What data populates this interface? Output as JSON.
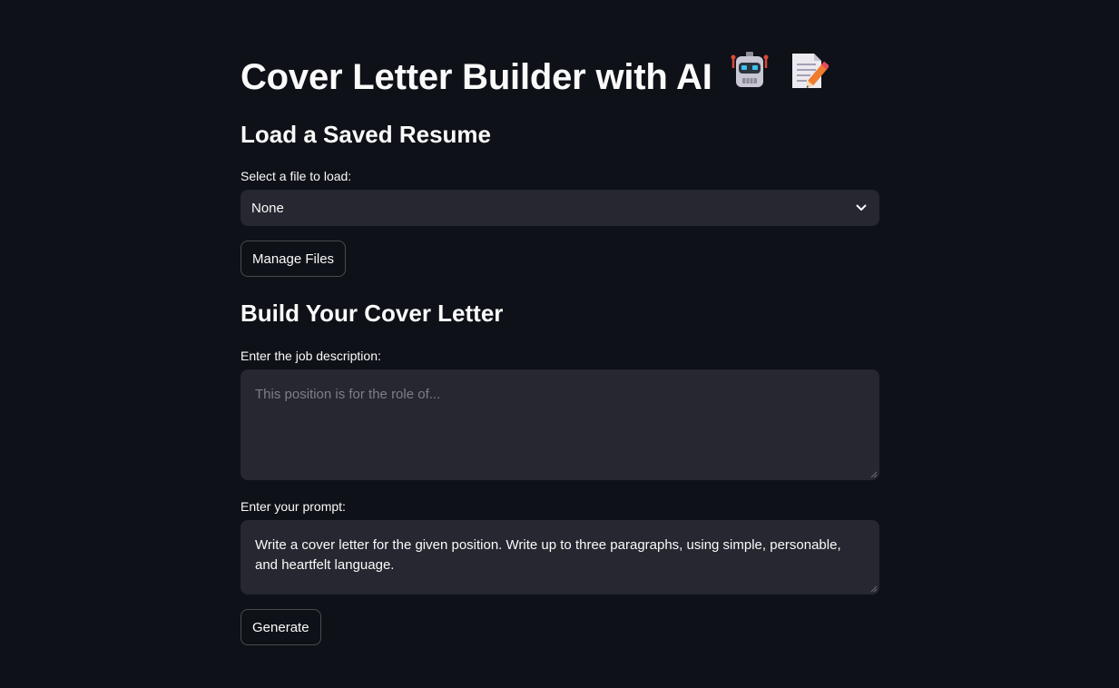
{
  "page": {
    "title": "Cover Letter Builder with AI",
    "title_emoji_1": "robot-icon",
    "title_emoji_2": "memo-icon"
  },
  "load_section": {
    "heading": "Load a Saved Resume",
    "select_label": "Select a file to load:",
    "select_value": "None",
    "manage_button": "Manage Files"
  },
  "build_section": {
    "heading": "Build Your Cover Letter",
    "job_label": "Enter the job description:",
    "job_placeholder": "This position is for the role of...",
    "job_value": "",
    "prompt_label": "Enter your prompt:",
    "prompt_value": "Write a cover letter for the given position. Write up to three paragraphs, using simple, personable, and heartfelt language.",
    "generate_button": "Generate"
  },
  "colors": {
    "background": "#0e1117",
    "input_bg": "#262730",
    "text": "#fafafa",
    "placeholder": "#7d7f86"
  }
}
